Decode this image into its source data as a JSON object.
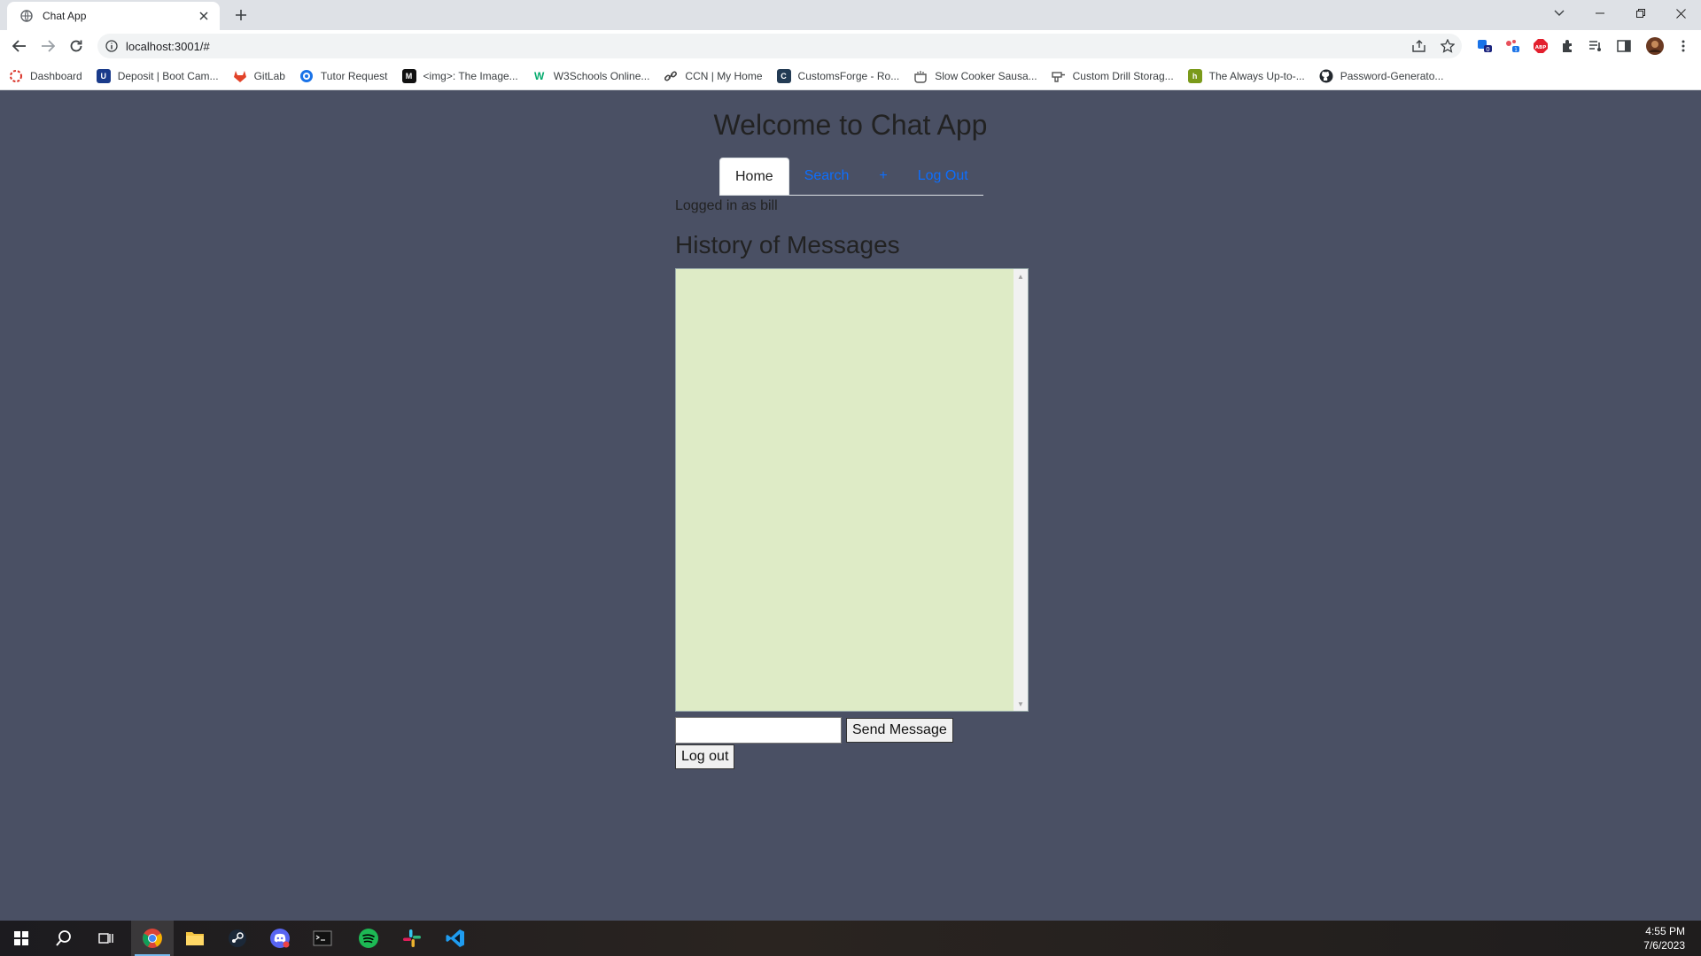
{
  "browser": {
    "tab_title": "Chat App",
    "url": "localhost:3001/#",
    "bookmarks": [
      {
        "label": "Dashboard",
        "icon": "dashboard-icon",
        "color": "#d93025"
      },
      {
        "label": "Deposit | Boot Cam...",
        "icon": "ucr-icon",
        "color": "#1a3b8b"
      },
      {
        "label": "GitLab",
        "icon": "gitlab-icon",
        "color": "#e24329"
      },
      {
        "label": "Tutor Request",
        "icon": "tutor-icon",
        "color": "#1a73e8"
      },
      {
        "label": "<img>: The Image...",
        "icon": "mdn-icon",
        "color": "#111111"
      },
      {
        "label": "W3Schools Online...",
        "icon": "w3schools-icon",
        "color": "#04aa6d"
      },
      {
        "label": "CCN | My Home",
        "icon": "link-icon",
        "color": "#444444"
      },
      {
        "label": "CustomsForge - Ro...",
        "icon": "customsforge-icon",
        "color": "#233b54"
      },
      {
        "label": "Slow Cooker Sausa...",
        "icon": "cooker-icon",
        "color": "#555555"
      },
      {
        "label": "Custom Drill Storag...",
        "icon": "drill-icon",
        "color": "#555555"
      },
      {
        "label": "The Always Up-to-...",
        "icon": "always-icon",
        "color": "#7a9a1a"
      },
      {
        "label": "Password-Generato...",
        "icon": "github-icon",
        "color": "#24292f"
      }
    ]
  },
  "app": {
    "title": "Welcome to Chat App",
    "nav": [
      {
        "label": "Home",
        "active": true
      },
      {
        "label": "Search",
        "active": false
      },
      {
        "label": "+",
        "active": false
      },
      {
        "label": "Log Out",
        "active": false
      }
    ],
    "logged_in_text": "Logged in as bill",
    "history_heading": "History of Messages",
    "messages": [],
    "message_input_value": "",
    "send_button": "Send Message",
    "logout_button": "Log out"
  },
  "taskbar": {
    "time": "4:55 PM",
    "date": "7/6/2023",
    "apps": [
      "start-icon",
      "search-icon",
      "task-view-icon",
      "chrome-icon",
      "file-explorer-icon",
      "steam-icon",
      "discord-icon",
      "terminal-icon",
      "spotify-icon",
      "slack-icon",
      "vscode-icon"
    ]
  },
  "colors": {
    "page_background": "#4a5064",
    "message_box_background": "#deebc6",
    "nav_link": "#0d6efd"
  }
}
